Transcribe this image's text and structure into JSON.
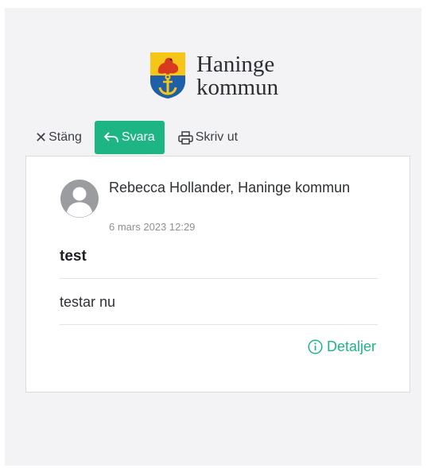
{
  "brand": {
    "line1": "Haninge",
    "line2": "kommun",
    "colors": {
      "shield_top": "#f5c518",
      "shield_bottom": "#1f5fa8",
      "bird": "#d83a1f",
      "anchor": "#f5c518"
    }
  },
  "toolbar": {
    "close_icon": "close-icon",
    "close_label": "Stäng",
    "reply_icon": "reply-icon",
    "reply_label": "Svara",
    "print_icon": "printer-icon",
    "print_label": "Skriv ut"
  },
  "message": {
    "avatar_icon": "user-avatar-icon",
    "sender": "Rebecca Hollander, Haninge kommun",
    "date": "6 mars 2023 12:29",
    "subject": "test",
    "body": "testar nu",
    "details_icon": "info-icon",
    "details_label": "Detaljer"
  },
  "colors": {
    "accent": "#1db584",
    "background": "#f3f3f6",
    "card": "#ffffff"
  }
}
